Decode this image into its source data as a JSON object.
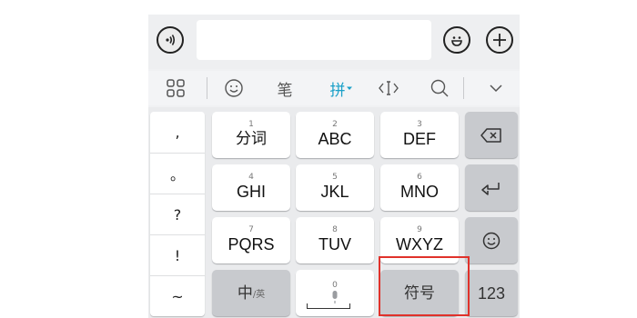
{
  "toolbar": {
    "handwriting_label": "笔",
    "pinyin_label": "拼"
  },
  "keyboard": {
    "punctuation": [
      ",",
      "。",
      "?",
      "!",
      "~"
    ],
    "keys": [
      {
        "num": "1",
        "label": "分词"
      },
      {
        "num": "2",
        "label": "ABC"
      },
      {
        "num": "3",
        "label": "DEF"
      },
      {
        "num": "4",
        "label": "GHI"
      },
      {
        "num": "5",
        "label": "JKL"
      },
      {
        "num": "6",
        "label": "MNO"
      },
      {
        "num": "7",
        "label": "PQRS"
      },
      {
        "num": "8",
        "label": "TUV"
      },
      {
        "num": "9",
        "label": "WXYZ"
      }
    ],
    "chinese_label": "中",
    "english_sublabel": "/英",
    "space_num": "0",
    "symbols_label": "符号",
    "numbers_label": "123"
  },
  "colors": {
    "accent": "#1aa0c8",
    "highlight": "#e0322b",
    "gray_key": "#c8cace"
  }
}
